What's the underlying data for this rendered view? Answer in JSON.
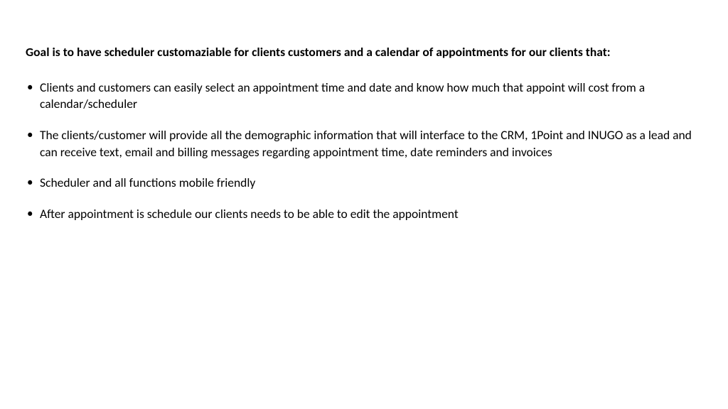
{
  "heading": "Goal is to have scheduler customaziable for clients customers and a calendar of  appointments for our clients that:",
  "bullets": [
    "Clients and customers can easily select an appointment time and date and know how much that appoint will cost from a calendar/scheduler",
    "The clients/customer will provide all the demographic information that will interface to the CRM, 1Point and INUGO as a lead and can receive text, email and billing messages regarding appointment time, date reminders and invoices",
    "Scheduler and all functions mobile friendly",
    "After appointment is schedule our clients needs to be able to edit the appointment"
  ]
}
